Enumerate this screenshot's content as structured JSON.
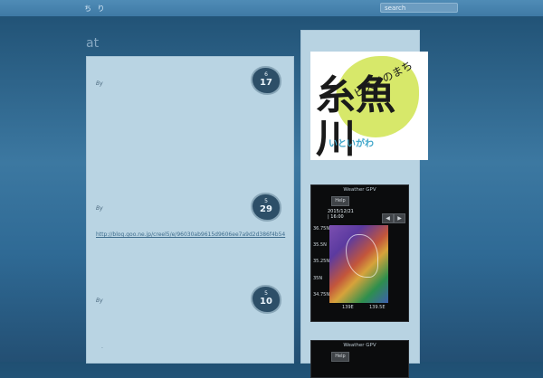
{
  "topbar": {
    "nav_text": "ち り",
    "search_placeholder": "search"
  },
  "site_title": "at",
  "posts": [
    {
      "by": "By",
      "month": "6",
      "day": "17"
    },
    {
      "by": "By",
      "month": "5",
      "day": "29",
      "link": "http://blog.goo.ne.jp/creel5/e/96030ab9615d9606ee7a9d2d386f4b54"
    },
    {
      "by": "By",
      "month": "5",
      "day": "10",
      "extra": "."
    }
  ],
  "sidebar": {
    "logo": {
      "kana_top": "ヒスイのまち",
      "kanji": "糸魚川",
      "kana_bottom": "いといがわ"
    },
    "widgets": [
      {
        "title": "Weather GPV",
        "help_label": "Help",
        "date": "2015/12/21",
        "time": "| 16:00",
        "prev": "◀",
        "next": "▶",
        "lat_labels": [
          "36.75N",
          "35.5N",
          "35.25N",
          "35N",
          "34.75N"
        ],
        "lon_labels": [
          "139E",
          "139.5E"
        ]
      },
      {
        "title": "Weather GPV",
        "help_label": "Help"
      }
    ]
  },
  "colors": {
    "accent": "#2d4f68",
    "background": "#2f6a95"
  }
}
